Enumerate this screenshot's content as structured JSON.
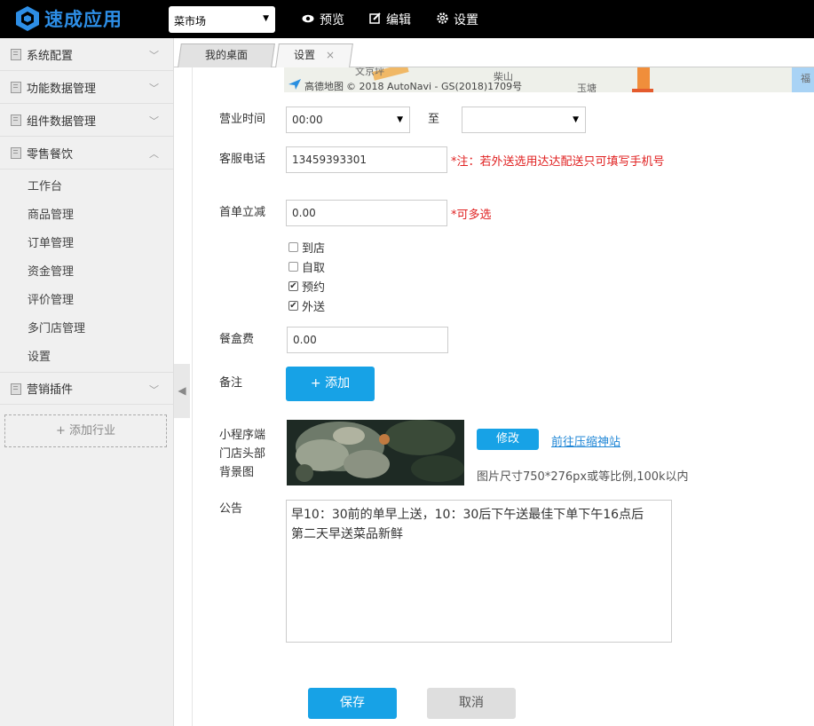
{
  "app": {
    "logo_text": "速成应用",
    "brand_color": "#2d8ee6"
  },
  "header": {
    "store_select": "菜市场",
    "menu": [
      {
        "label": "预览",
        "icon": "eye-icon"
      },
      {
        "label": "编辑",
        "icon": "edit-icon"
      },
      {
        "label": "设置",
        "icon": "gear-icon"
      }
    ]
  },
  "sidebar": {
    "groups": [
      {
        "label": "系统配置",
        "expanded": false
      },
      {
        "label": "功能数据管理",
        "expanded": false
      },
      {
        "label": "组件数据管理",
        "expanded": false
      },
      {
        "label": "零售餐饮",
        "expanded": true
      },
      {
        "label": "营销插件",
        "expanded": false
      }
    ],
    "items": [
      "工作台",
      "商品管理",
      "订单管理",
      "资金管理",
      "评价管理",
      "多门店管理",
      "设置"
    ],
    "add_industry": "+ 添加行业"
  },
  "tabs": [
    {
      "label": "我的桌面",
      "closable": false
    },
    {
      "label": "设置",
      "closable": true,
      "active": true
    }
  ],
  "map": {
    "labels": [
      "文京坪",
      "柴山",
      "玉塘",
      "福"
    ],
    "credit": "高德地图",
    "copyright": "© 2018 AutoNavi - GS(2018)1709号"
  },
  "form": {
    "hours": {
      "label": "营业时间",
      "start": "00:00",
      "separator": "至",
      "end": ""
    },
    "phone": {
      "label": "客服电话",
      "value": "13459393301",
      "note": "*注：若外送选用达达配送只可填写手机号"
    },
    "first_discount": {
      "label": "首单立减",
      "value": "0.00",
      "note": "*可多选"
    },
    "service_options": [
      {
        "label": "到店",
        "checked": false
      },
      {
        "label": "自取",
        "checked": false
      },
      {
        "label": "预约",
        "checked": true
      },
      {
        "label": "外送",
        "checked": true
      }
    ],
    "box_fee": {
      "label": "餐盒费",
      "value": "0.00"
    },
    "remark": {
      "label": "备注",
      "add_button": "+ 添加"
    },
    "background": {
      "label_lines": [
        "小程序端",
        "门店头部",
        "背景图"
      ],
      "modify_button": "修改",
      "compress_link": "前往压缩神站",
      "hint": "图片尺寸750*276px或等比例,100k以内"
    },
    "notice": {
      "label": "公告",
      "value": "早10：30前的单早上送，10：30后下午送最佳下单下午16点后\n第二天早送菜品新鲜"
    },
    "save_button": "保存",
    "cancel_button": "取消"
  }
}
